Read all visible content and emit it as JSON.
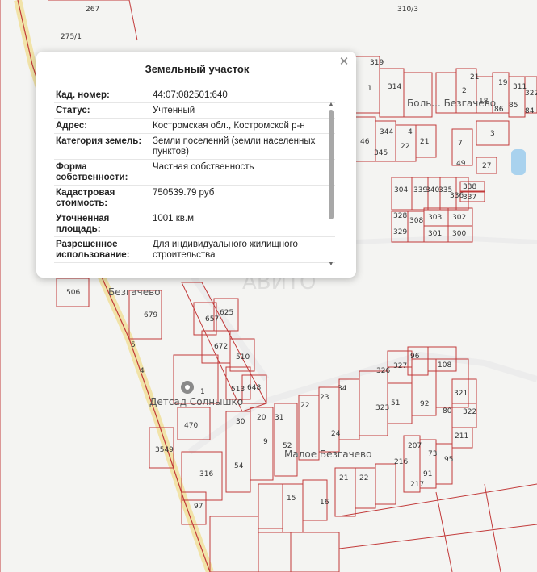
{
  "map": {
    "street_labels": {
      "upper_village": "Боль... Безгачево",
      "mid_village": "Безгачево",
      "lower_village": "Малое Безгачево"
    },
    "poi": {
      "label": "Детсад Солнышко",
      "icon": "kindergarten-pin-icon"
    },
    "parcel_labels": [
      "267",
      "275/1",
      "310/3",
      "319",
      "1",
      "314",
      "311",
      "2",
      "18",
      "19",
      "21",
      "322",
      "84",
      "85",
      "86",
      "66",
      "46",
      "344",
      "345",
      "22",
      "21",
      "7",
      "4",
      "3",
      "27",
      "49",
      "304",
      "339",
      "340",
      "335",
      "336",
      "338",
      "337",
      "328",
      "329",
      "308",
      "303",
      "302",
      "301",
      "300",
      "506",
      "679",
      "657",
      "625",
      "672",
      "510",
      "513",
      "648",
      "1",
      "4",
      "5",
      "470",
      "3549",
      "316",
      "97",
      "34",
      "326",
      "327",
      "96",
      "108",
      "321",
      "322",
      "80",
      "323",
      "51",
      "92",
      "211",
      "20",
      "22",
      "23",
      "30",
      "31",
      "52",
      "24",
      "9",
      "54",
      "207",
      "73",
      "95",
      "216",
      "91",
      "21",
      "22",
      "217",
      "15",
      "16"
    ],
    "watermark": "АВИТО"
  },
  "popup": {
    "title": "Земельный участок",
    "close_icon": "close-icon",
    "rows": [
      {
        "key": "Кад. номер:",
        "value": "44:07:082501:640"
      },
      {
        "key": "Статус:",
        "value": "Учтенный"
      },
      {
        "key": "Адрес:",
        "value": "Костромская обл., Костромской р-н"
      },
      {
        "key": "Категория земель:",
        "value": "Земли поселений (земли населенных пунктов)"
      },
      {
        "key": "Форма собственности:",
        "value": "Частная собственность"
      },
      {
        "key": "Кадастровая стоимость:",
        "value": "750539.79 руб"
      },
      {
        "key": "Уточненная площадь:",
        "value": "1001 кв.м"
      },
      {
        "key": "Разрешенное использование:",
        "value": "Для индивидуального жилищного строительства"
      }
    ]
  },
  "colors": {
    "parcel_border": "#c23a3a",
    "road": "#f1e3a8",
    "background": "#f4f4f2",
    "water": "#a9d2ee",
    "popup_bg": "#ffffff"
  }
}
